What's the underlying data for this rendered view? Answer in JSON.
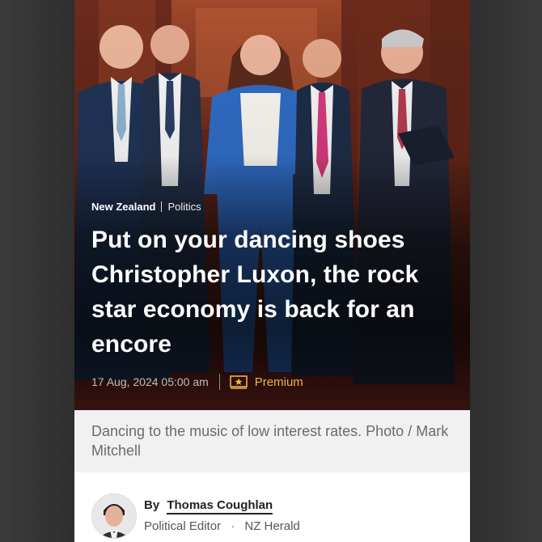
{
  "article": {
    "section": "New Zealand",
    "subsection": "Politics",
    "headline": "Put on your dancing shoes Christopher Luxon, the rock star economy is back for an encore",
    "timestamp": "17 Aug, 2024 05:00 am",
    "premium_label": "Premium",
    "caption": "Dancing to the music of low interest rates. Photo / Mark Mitchell"
  },
  "byline": {
    "prefix": "By",
    "author": "Thomas Coughlan",
    "role": "Political Editor",
    "separator": "·",
    "publication": "NZ Herald"
  },
  "colors": {
    "premium_accent": "#f2b43c",
    "caption_background": "#f1f1f1",
    "headline_text": "#ffffff"
  },
  "icons": {
    "premium": "premium-star-icon",
    "author_photo": "author-avatar"
  }
}
